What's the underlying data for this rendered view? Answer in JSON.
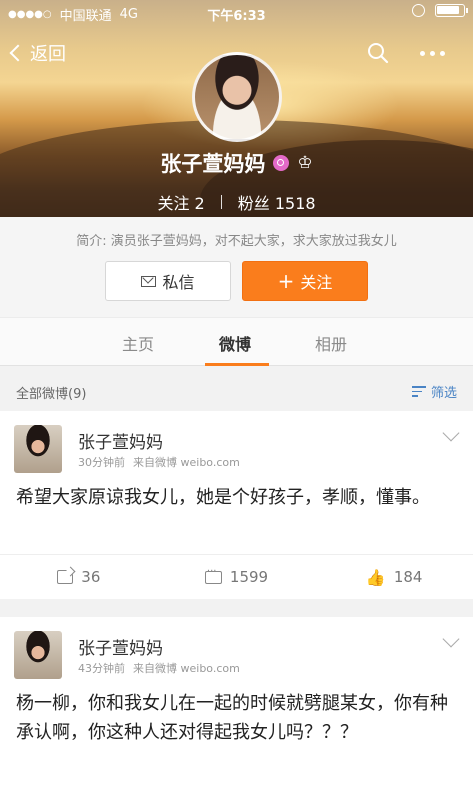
{
  "status": {
    "carrier": "中国联通",
    "network": "4G",
    "time": "下午6:33"
  },
  "nav": {
    "back_label": "返回"
  },
  "profile": {
    "name": "张子萱妈妈",
    "following_label": "关注",
    "following_count": "2",
    "fans_label": "粉丝",
    "fans_count": "1518",
    "bio": "简介: 演员张子萱妈妈，对不起大家，求大家放过我女儿"
  },
  "actions": {
    "message_label": "私信",
    "follow_label": "关注"
  },
  "tabs": [
    {
      "label": "主页",
      "active": false
    },
    {
      "label": "微博",
      "active": true
    },
    {
      "label": "相册",
      "active": false
    }
  ],
  "list_header": {
    "label": "全部微博(9)",
    "filter_label": "筛选"
  },
  "posts": [
    {
      "username": "张子萱妈妈",
      "time": "30分钟前",
      "source": "来自微博 weibo.com",
      "text": "希望大家原谅我女儿，她是个好孩子，孝顺，懂事。",
      "reposts": "36",
      "comments": "1599",
      "likes": "184"
    },
    {
      "username": "张子萱妈妈",
      "time": "43分钟前",
      "source": "来自微博 weibo.com",
      "text": "杨一柳，你和我女儿在一起的时候就劈腿某女，你有种承认啊，你这种人还对得起我女儿吗？？？"
    }
  ],
  "colors": {
    "accent": "#fa7d1c",
    "link": "#4a84c5"
  }
}
